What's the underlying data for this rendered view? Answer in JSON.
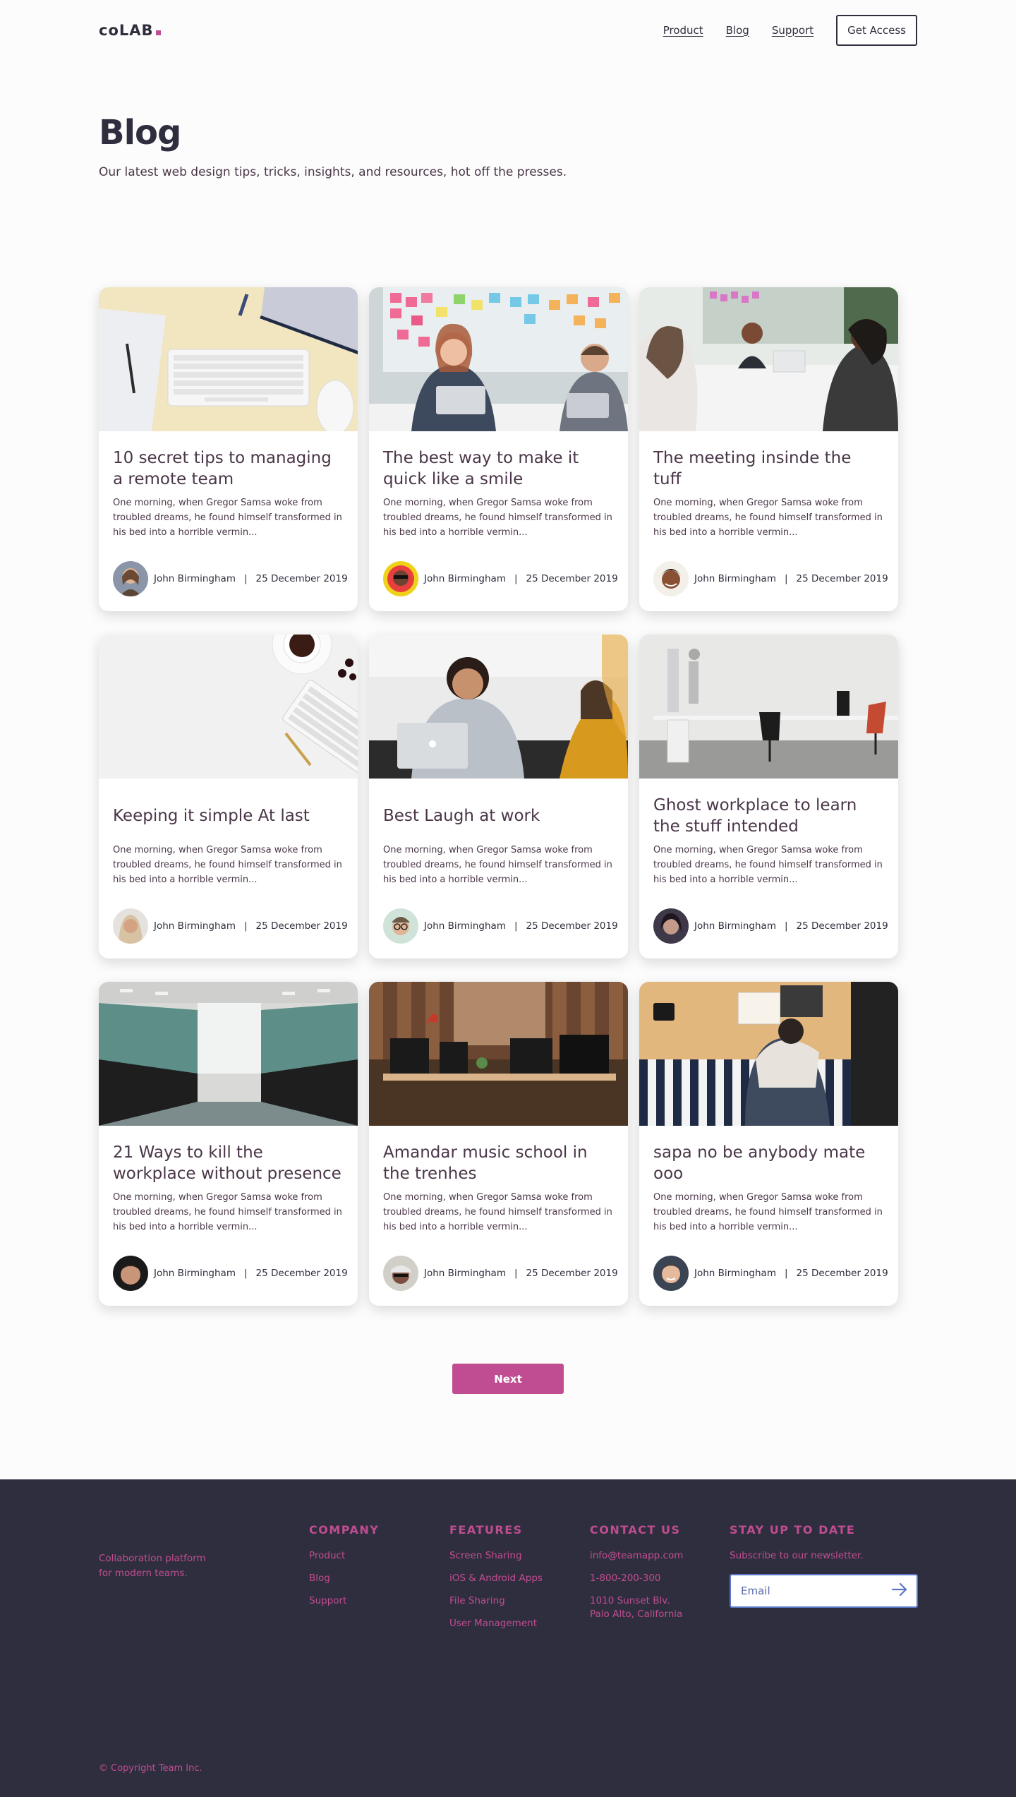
{
  "header": {
    "logo": "coLAB",
    "nav": [
      "Product",
      "Blog",
      "Support"
    ],
    "cta": "Get Access"
  },
  "hero": {
    "title": "Blog",
    "subtitle": "Our latest web design tips, tricks, insights, and resources, hot off the presses."
  },
  "posts": [
    {
      "title": "10 secret tips to managing a remote team",
      "excerpt": "One morning, when Gregor Samsa woke from troubled dreams, he found himself transformed in his bed into a horrible vermin...",
      "author": "John Birmingham",
      "date": "25 December 2019"
    },
    {
      "title": "The best way to make it quick like a smile",
      "excerpt": "One morning, when Gregor Samsa woke from troubled dreams, he found himself transformed in his bed into a horrible vermin...",
      "author": "John Birmingham",
      "date": "25 December 2019"
    },
    {
      "title": "The meeting insinde the tuff",
      "excerpt": "One morning, when Gregor Samsa woke from troubled dreams, he found himself transformed in his bed into a horrible vermin...",
      "author": "John Birmingham",
      "date": "25 December 2019"
    },
    {
      "title": "Keeping it simple At last",
      "excerpt": "One morning, when Gregor Samsa woke from troubled dreams, he found himself transformed in his bed into a horrible vermin...",
      "author": "John Birmingham",
      "date": "25 December 2019"
    },
    {
      "title": "Best Laugh at work",
      "excerpt": "One morning, when Gregor Samsa woke from troubled dreams, he found himself transformed in his bed into a horrible vermin...",
      "author": "John Birmingham",
      "date": "25 December 2019"
    },
    {
      "title": "Ghost workplace to learn the stuff intended",
      "excerpt": "One morning, when Gregor Samsa woke from troubled dreams, he found himself transformed in his bed into a horrible vermin...",
      "author": "John Birmingham",
      "date": "25 December 2019"
    },
    {
      "title": "21 Ways to kill the workplace without presence",
      "excerpt": "One morning, when Gregor Samsa woke from troubled dreams, he found himself transformed in his bed into a horrible vermin...",
      "author": "John Birmingham",
      "date": "25 December 2019"
    },
    {
      "title": "Amandar music school in the trenhes",
      "excerpt": "One morning, when Gregor Samsa woke from troubled dreams, he found himself transformed in his bed into a horrible vermin...",
      "author": "John Birmingham",
      "date": "25 December 2019"
    },
    {
      "title": "sapa no be anybody mate ooo",
      "excerpt": "One morning, when Gregor Samsa woke from troubled dreams, he found himself transformed in his bed into a horrible vermin...",
      "author": "John Birmingham",
      "date": "25 December 2019"
    }
  ],
  "meta_separator": "|",
  "pagination": {
    "next": "Next"
  },
  "footer": {
    "tagline": "Collaboration platform\nfor modern teams.",
    "company": {
      "heading": "COMPANY",
      "links": [
        "Product",
        "Blog",
        "Support"
      ]
    },
    "features": {
      "heading": "FEATURES",
      "links": [
        "Screen Sharing",
        "iOS & Android Apps",
        "File Sharing",
        "User Management"
      ]
    },
    "contact": {
      "heading": "CONTACT US",
      "links": [
        "info@teamapp.com",
        "1-800-200-300",
        "1010 Sunset Blv.\nPalo Alto, California"
      ]
    },
    "newsletter": {
      "heading": "STAY UP TO DATE",
      "text": "Subscribe to our newsletter.",
      "placeholder": "Email"
    },
    "copyright": "© Copyright Team Inc."
  },
  "colors": {
    "accent": "#c04d91",
    "dark": "#2f2e3e",
    "input_border": "#5b76c8"
  }
}
